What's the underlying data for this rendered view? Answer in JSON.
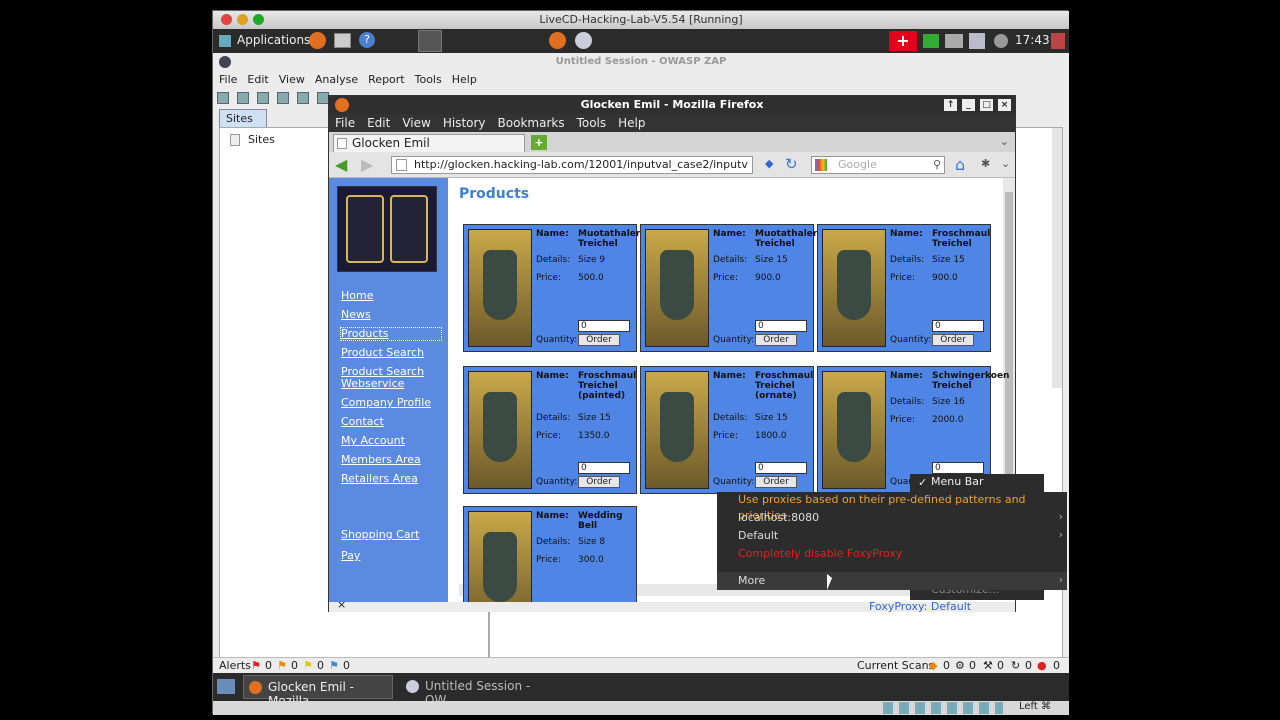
{
  "vbox": {
    "title": "LiveCD-Hacking-Lab-V5.54 [Running]"
  },
  "panel": {
    "applications": "Applications",
    "clock": "17:43"
  },
  "zap": {
    "title": "Untitled Session - OWASP ZAP",
    "menu": [
      "File",
      "Edit",
      "View",
      "Analyse",
      "Report",
      "Tools",
      "Help"
    ],
    "sites_tab": "Sites",
    "sites_tree_item": "Sites",
    "alerts_label": "Alerts",
    "alerts_counts": [
      "0",
      "0",
      "0",
      "0"
    ],
    "current_scans_label": "Current Scans",
    "scan_counts": [
      "0",
      "0",
      "0",
      "0",
      "0"
    ]
  },
  "firefox": {
    "title": "Glocken Emil - Mozilla Firefox",
    "menu": [
      "File",
      "Edit",
      "View",
      "History",
      "Bookmarks",
      "Tools",
      "Help"
    ],
    "tab_label": "Glocken Emil",
    "url": "http://glocken.hacking-lab.com/12001/inputval_case2/inputv",
    "search_placeholder": "Google",
    "status_right": "FoxyProxy: Default"
  },
  "site": {
    "heading": "Products",
    "nav": [
      "Home",
      "News",
      "Products",
      "Product Search",
      "Product Search Webservice",
      "Company Profile",
      "Contact",
      "My Account",
      "Members Area",
      "Retailers Area",
      "Shopping Cart",
      "Pay"
    ],
    "labels": {
      "name": "Name:",
      "details": "Details:",
      "price": "Price:",
      "quantity": "Quantity:",
      "order": "Order"
    },
    "products": [
      {
        "name": "Muotathaler Treichel",
        "details": "Size 9",
        "price": "500.0",
        "qty": "0"
      },
      {
        "name": "Muotathaler Treichel",
        "details": "Size 15",
        "price": "900.0",
        "qty": "0"
      },
      {
        "name": "Froschmaul Treichel",
        "details": "Size 15",
        "price": "900.0",
        "qty": "0"
      },
      {
        "name": "Froschmaul Treichel (painted)",
        "details": "Size 15",
        "price": "1350.0",
        "qty": "0"
      },
      {
        "name": "Froschmaul Treichel (ornate)",
        "details": "Size 15",
        "price": "1800.0",
        "qty": "0"
      },
      {
        "name": "Schwingerkoen Treichel",
        "details": "Size 16",
        "price": "2000.0",
        "qty": "0"
      },
      {
        "name": "Wedding Bell",
        "details": "Size 8",
        "price": "300.0",
        "qty": ""
      }
    ]
  },
  "context_small": {
    "menu_bar": "Menu Bar",
    "customize": "Customize..."
  },
  "context_big": {
    "items": [
      "Use proxies based on their pre-defined patterns and priorities",
      "localhost:8080",
      "Default",
      "Completely disable FoxyProxy",
      "More"
    ]
  },
  "taskbar": {
    "items": [
      "Glocken Emil - Mozilla...",
      "Untitled Session - OW..."
    ],
    "right": "Left ⌘"
  }
}
